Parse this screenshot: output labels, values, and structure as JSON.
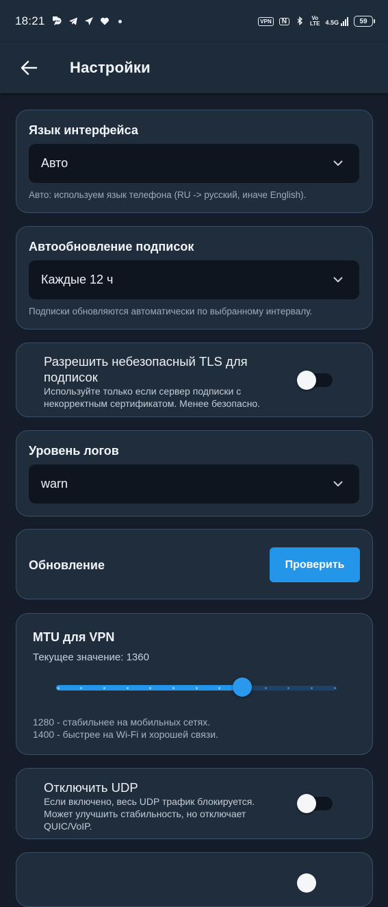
{
  "status_bar": {
    "time": "18:21",
    "vpn_badge": "VPN",
    "nfc_badge": "N",
    "volte_top": "Vo",
    "volte_bottom": "LTE",
    "network": "4.5G",
    "battery": "59"
  },
  "appbar": {
    "title": "Настройки"
  },
  "language": {
    "title": "Язык интерфейса",
    "value": "Авто",
    "helper": "Авто: используем язык телефона (RU -> русский, иначе English)."
  },
  "autoupdate": {
    "title": "Автообновление подписок",
    "value": "Каждые 12 ч",
    "helper": "Подписки обновляются автоматически по выбранному интервалу."
  },
  "insecure_tls": {
    "title_line1": "Разрешить небезопасный TLS для",
    "title_line2": "подписок",
    "desc_line1": "Используйте только если сервер подписки с",
    "desc_line2": "некорректным сертификатом. Менее безопасно.",
    "enabled": false
  },
  "log_level": {
    "title": "Уровень логов",
    "value": "warn"
  },
  "update": {
    "title": "Обновление",
    "button": "Проверить"
  },
  "mtu": {
    "title": "MTU для VPN",
    "current": "Текущее значение: 1360",
    "min": 1280,
    "max": 1400,
    "step": 10,
    "value": 1360,
    "help_line1": "1280 - стабильнее на мобильных сетях.",
    "help_line2": "1400 - быстрее на Wi-Fi и хорошей связи."
  },
  "disable_udp": {
    "title": "Отключить UDP",
    "desc_line1": "Если включено, весь UDP трафик блокируется.",
    "desc_line2": "Может улучшить стабильность, но отключает",
    "desc_line3": "QUIC/VoIP.",
    "enabled": false
  },
  "colors": {
    "background": "#141d29",
    "card": "#1f2d3d",
    "accent": "#2496ea"
  }
}
